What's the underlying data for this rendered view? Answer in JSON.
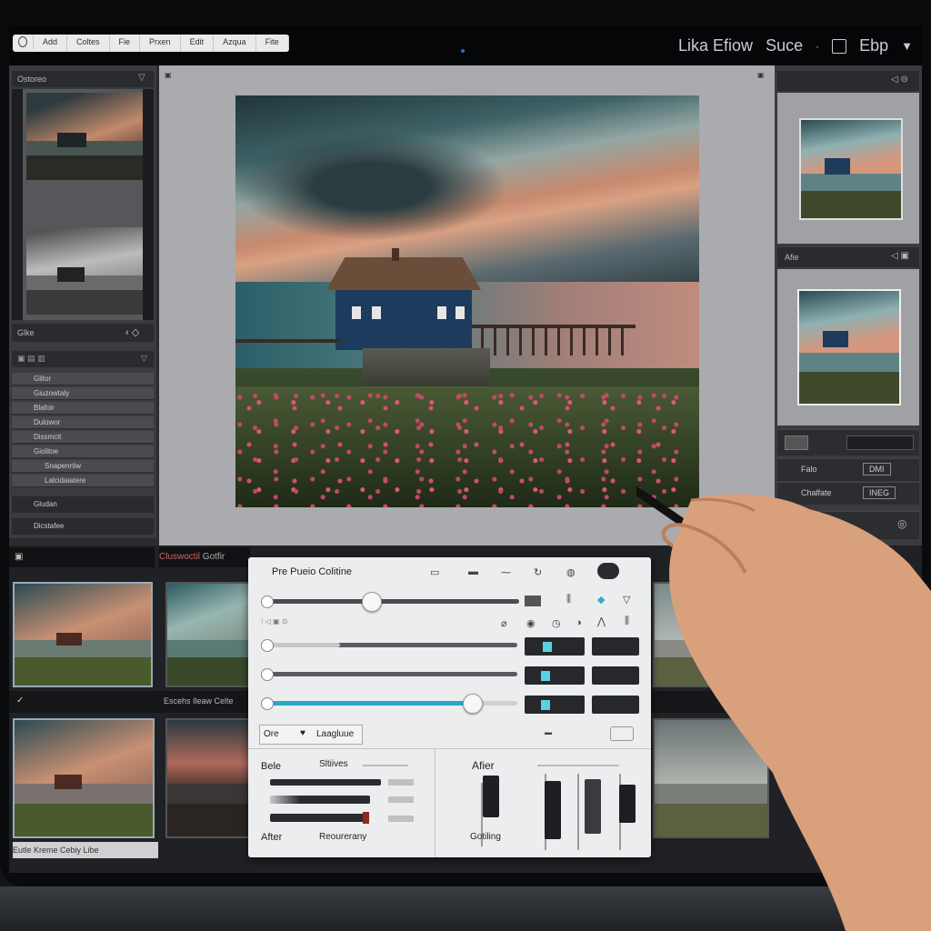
{
  "topbar": {
    "tabs": [
      "Add",
      "Coltes",
      "Fie",
      "Prxen",
      "Edit",
      "Azqua",
      "Fite"
    ],
    "right_text_1": "Lika Efiow",
    "right_text_2": "Suce",
    "right_dot": "·",
    "right_text_3": "Ebp"
  },
  "left_panel": {
    "header": "Ostoreo",
    "section_2": "Glke",
    "list_items": [
      "Glitor",
      "Giuzowtaly",
      "Blafoir",
      "Dulowor",
      "Dissmcit",
      "Giolitoe",
      "Snapenrtiw",
      "Lalcidaiatere"
    ],
    "footer_1": "Gludan",
    "footer_2": "Dicstafee"
  },
  "right_panel": {
    "header_2": "Afie",
    "row_labels": [
      "Falo",
      "Chalfate"
    ],
    "row_values": [
      "DMI",
      "INEG"
    ]
  },
  "filmstrip": {
    "bar_label_1": "Cluswoctil",
    "bar_label_2": "Gotfir",
    "bar_label_3": "Escehs Ileaw Celte",
    "bottom_label": "Eutle Kreme Cebiy Libe"
  },
  "edit_panel": {
    "title": "Pre Pueio Colitine",
    "sub_label": "Ore",
    "sub_label_2": "Laagluue",
    "before_label": "Bele",
    "sharp_label": "Sltiives",
    "after_label": "After",
    "after_label_2": "Afier",
    "bottom_label": "Reourerany",
    "right_bottom_label": "Gotiling",
    "slider_values": [
      0.42,
      0.3,
      0.0,
      0.82
    ],
    "accent_color": "#2aa7c9"
  }
}
